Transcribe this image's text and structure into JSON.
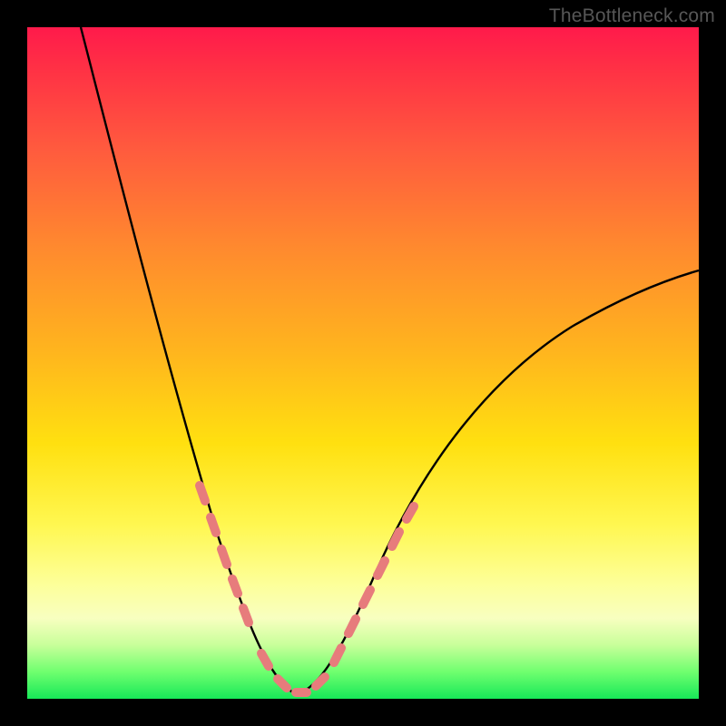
{
  "watermark": "TheBottleneck.com",
  "chart_data": {
    "type": "line",
    "title": "",
    "xlabel": "",
    "ylabel": "",
    "xlim": [
      0,
      100
    ],
    "ylim": [
      0,
      100
    ],
    "grid": false,
    "legend": false,
    "series": [
      {
        "name": "bottleneck-curve",
        "x": [
          8,
          10,
          12,
          14,
          16,
          18,
          20,
          22,
          24,
          26,
          28,
          30,
          32,
          34,
          36,
          38,
          40,
          44,
          48,
          52,
          56,
          60,
          64,
          68,
          72,
          76,
          80,
          84,
          88,
          92,
          96,
          100
        ],
        "y": [
          100,
          92,
          84,
          76,
          68,
          60,
          52,
          45,
          38,
          32,
          26,
          20,
          14,
          9,
          5,
          2,
          0,
          2,
          6,
          11,
          16,
          21,
          26,
          31,
          35,
          39,
          43,
          46,
          49,
          52,
          54,
          56
        ],
        "color": "#000000"
      },
      {
        "name": "highlight-dots-left",
        "x": [
          26,
          27.5,
          29,
          30.5,
          32,
          33.5
        ],
        "y": [
          31,
          27,
          23,
          19,
          15,
          11
        ],
        "color": "#e77c7c"
      },
      {
        "name": "highlight-dots-bottom",
        "x": [
          35,
          37,
          39,
          41,
          43
        ],
        "y": [
          3,
          1,
          0,
          1,
          3
        ],
        "color": "#e77c7c"
      },
      {
        "name": "highlight-dots-right",
        "x": [
          45,
          46.5,
          48,
          49.5,
          51,
          52.5,
          54
        ],
        "y": [
          7,
          10,
          13,
          16,
          19,
          22,
          25
        ],
        "color": "#e77c7c"
      }
    ],
    "annotations": []
  }
}
